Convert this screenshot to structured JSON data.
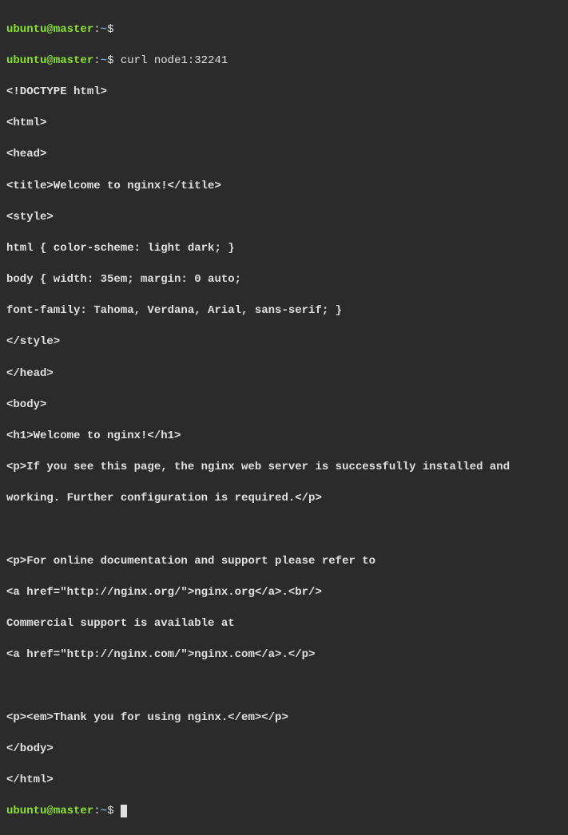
{
  "prompt": {
    "user": "ubuntu",
    "at": "@",
    "host": "master",
    "colon": ":",
    "path": "~",
    "dollar": "$"
  },
  "command1": "",
  "command2": " curl node1:32241",
  "output": {
    "l1": "<!DOCTYPE html>",
    "l2": "<html>",
    "l3": "<head>",
    "l4": "<title>Welcome to nginx!</title>",
    "l5": "<style>",
    "l6": "html { color-scheme: light dark; }",
    "l7": "body { width: 35em; margin: 0 auto;",
    "l8": "font-family: Tahoma, Verdana, Arial, sans-serif; }",
    "l9": "</style>",
    "l10": "</head>",
    "l11": "<body>",
    "l12": "<h1>Welcome to nginx!</h1>",
    "l13": "<p>If you see this page, the nginx web server is successfully installed and",
    "l14": "working. Further configuration is required.</p>",
    "l15": "",
    "l16": "<p>For online documentation and support please refer to",
    "l17": "<a href=\"http://nginx.org/\">nginx.org</a>.<br/>",
    "l18": "Commercial support is available at",
    "l19": "<a href=\"http://nginx.com/\">nginx.com</a>.</p>",
    "l20": "",
    "l21": "<p><em>Thank you for using nginx.</em></p>",
    "l22": "</body>",
    "l23": "</html>"
  }
}
